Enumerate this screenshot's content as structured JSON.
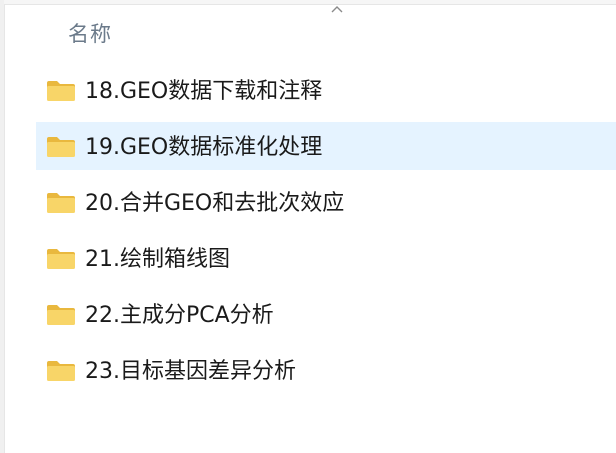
{
  "header": {
    "name_column": "名称"
  },
  "files": [
    {
      "name": "18.GEO数据下载和注释",
      "icon": "folder-icon",
      "selected": false
    },
    {
      "name": "19.GEO数据标准化处理",
      "icon": "folder-icon",
      "selected": true
    },
    {
      "name": "20.合并GEO和去批次效应",
      "icon": "folder-icon",
      "selected": false
    },
    {
      "name": "21.绘制箱线图",
      "icon": "folder-icon",
      "selected": false
    },
    {
      "name": "22.主成分PCA分析",
      "icon": "folder-icon",
      "selected": false
    },
    {
      "name": "23.目标基因差异分析",
      "icon": "folder-icon",
      "selected": false
    }
  ],
  "colors": {
    "folder": "#f8d568",
    "folder_dark": "#e9b83e",
    "selection": "#e5f3ff",
    "header_text": "#6b7a8a"
  }
}
